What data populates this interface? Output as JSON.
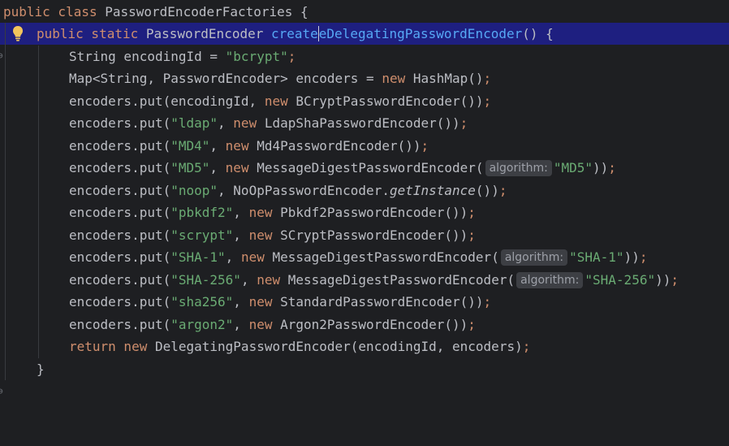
{
  "lines": [
    {
      "tokens": [
        {
          "t": "public class ",
          "c": "kw"
        },
        {
          "t": "PasswordEncoderFactories {",
          "c": ""
        }
      ]
    },
    {
      "tokens": [
        {
          "t": "public static ",
          "c": "kw"
        },
        {
          "t": "PasswordEncoder ",
          "c": ""
        },
        {
          "t": "create",
          "c": "fn"
        },
        {
          "t": "|",
          "c": "caret"
        },
        {
          "t": "eDelegatingPasswordEncoder",
          "c": "fn"
        },
        {
          "t": "() {",
          "c": ""
        }
      ]
    },
    {
      "tokens": [
        {
          "t": "String encodingId = ",
          "c": ""
        },
        {
          "t": "\"bcrypt\"",
          "c": "str"
        },
        {
          "t": ";",
          "c": "kw"
        }
      ]
    },
    {
      "tokens": [
        {
          "t": "Map<String, PasswordEncoder> encoders = ",
          "c": ""
        },
        {
          "t": "new ",
          "c": "kw"
        },
        {
          "t": "HashMap()",
          "c": ""
        },
        {
          "t": ";",
          "c": "kw"
        }
      ]
    },
    {
      "tokens": [
        {
          "t": "encoders.put(encodingId, ",
          "c": ""
        },
        {
          "t": "new ",
          "c": "kw"
        },
        {
          "t": "BCryptPasswordEncoder())",
          "c": ""
        },
        {
          "t": ";",
          "c": "kw"
        }
      ]
    },
    {
      "tokens": [
        {
          "t": "encoders.put(",
          "c": ""
        },
        {
          "t": "\"ldap\"",
          "c": "str"
        },
        {
          "t": ", ",
          "c": ""
        },
        {
          "t": "new ",
          "c": "kw"
        },
        {
          "t": "LdapShaPasswordEncoder())",
          "c": ""
        },
        {
          "t": ";",
          "c": "kw"
        }
      ]
    },
    {
      "tokens": [
        {
          "t": "encoders.put(",
          "c": ""
        },
        {
          "t": "\"MD4\"",
          "c": "str"
        },
        {
          "t": ", ",
          "c": ""
        },
        {
          "t": "new ",
          "c": "kw"
        },
        {
          "t": "Md4PasswordEncoder())",
          "c": ""
        },
        {
          "t": ";",
          "c": "kw"
        }
      ]
    },
    {
      "tokens": [
        {
          "t": "encoders.put(",
          "c": ""
        },
        {
          "t": "\"MD5\"",
          "c": "str"
        },
        {
          "t": ", ",
          "c": ""
        },
        {
          "t": "new ",
          "c": "kw"
        },
        {
          "t": "MessageDigestPasswordEncoder(",
          "c": ""
        },
        {
          "t": "algorithm:",
          "c": "hint"
        },
        {
          "t": "\"MD5\"",
          "c": "str"
        },
        {
          "t": "))",
          "c": ""
        },
        {
          "t": ";",
          "c": "kw"
        }
      ]
    },
    {
      "tokens": [
        {
          "t": "encoders.put(",
          "c": ""
        },
        {
          "t": "\"noop\"",
          "c": "str"
        },
        {
          "t": ", ",
          "c": ""
        },
        {
          "t": "NoOpPasswordEncoder.",
          "c": ""
        },
        {
          "t": "getInstance",
          "c": "it"
        },
        {
          "t": "())",
          "c": ""
        },
        {
          "t": ";",
          "c": "kw"
        }
      ]
    },
    {
      "tokens": [
        {
          "t": "encoders.put(",
          "c": ""
        },
        {
          "t": "\"pbkdf2\"",
          "c": "str"
        },
        {
          "t": ", ",
          "c": ""
        },
        {
          "t": "new ",
          "c": "kw"
        },
        {
          "t": "Pbkdf2PasswordEncoder())",
          "c": ""
        },
        {
          "t": ";",
          "c": "kw"
        }
      ]
    },
    {
      "tokens": [
        {
          "t": "encoders.put(",
          "c": ""
        },
        {
          "t": "\"scrypt\"",
          "c": "str"
        },
        {
          "t": ", ",
          "c": ""
        },
        {
          "t": "new ",
          "c": "kw"
        },
        {
          "t": "SCryptPasswordEncoder())",
          "c": ""
        },
        {
          "t": ";",
          "c": "kw"
        }
      ]
    },
    {
      "tokens": [
        {
          "t": "encoders.put(",
          "c": ""
        },
        {
          "t": "\"SHA-1\"",
          "c": "str"
        },
        {
          "t": ", ",
          "c": ""
        },
        {
          "t": "new ",
          "c": "kw"
        },
        {
          "t": "MessageDigestPasswordEncoder(",
          "c": ""
        },
        {
          "t": "algorithm:",
          "c": "hint"
        },
        {
          "t": "\"SHA-1\"",
          "c": "str"
        },
        {
          "t": "))",
          "c": ""
        },
        {
          "t": ";",
          "c": "kw"
        }
      ]
    },
    {
      "tokens": [
        {
          "t": "encoders.put(",
          "c": ""
        },
        {
          "t": "\"SHA-256\"",
          "c": "str"
        },
        {
          "t": ", ",
          "c": ""
        },
        {
          "t": "new ",
          "c": "kw"
        },
        {
          "t": "MessageDigestPasswordEncoder(",
          "c": ""
        },
        {
          "t": "algorithm:",
          "c": "hint"
        },
        {
          "t": "\"SHA-256\"",
          "c": "str"
        },
        {
          "t": "))",
          "c": ""
        },
        {
          "t": ";",
          "c": "kw"
        }
      ]
    },
    {
      "tokens": [
        {
          "t": "encoders.put(",
          "c": ""
        },
        {
          "t": "\"sha256\"",
          "c": "str"
        },
        {
          "t": ", ",
          "c": ""
        },
        {
          "t": "new ",
          "c": "kw"
        },
        {
          "t": "StandardPasswordEncoder())",
          "c": ""
        },
        {
          "t": ";",
          "c": "kw"
        }
      ]
    },
    {
      "tokens": [
        {
          "t": "encoders.put(",
          "c": ""
        },
        {
          "t": "\"argon2\"",
          "c": "str"
        },
        {
          "t": ", ",
          "c": ""
        },
        {
          "t": "new ",
          "c": "kw"
        },
        {
          "t": "Argon2PasswordEncoder())",
          "c": ""
        },
        {
          "t": ";",
          "c": "kw"
        }
      ]
    },
    {
      "tokens": [
        {
          "t": "return new ",
          "c": "kw"
        },
        {
          "t": "DelegatingPasswordEncoder(encodingId, encoders)",
          "c": ""
        },
        {
          "t": ";",
          "c": "kw"
        }
      ]
    },
    {
      "tokens": [
        {
          "t": "}",
          "c": ""
        }
      ]
    }
  ],
  "gutter": {
    "method_marker": "⊖",
    "close_marker": "⊖",
    "bulb_icon": "lightbulb-icon"
  },
  "colors": {
    "background": "#1e1f22",
    "current_line": "#1e1f80",
    "keyword": "#cf8e6d",
    "string": "#6aab73",
    "function": "#56a8f5",
    "text": "#bcbec4"
  }
}
